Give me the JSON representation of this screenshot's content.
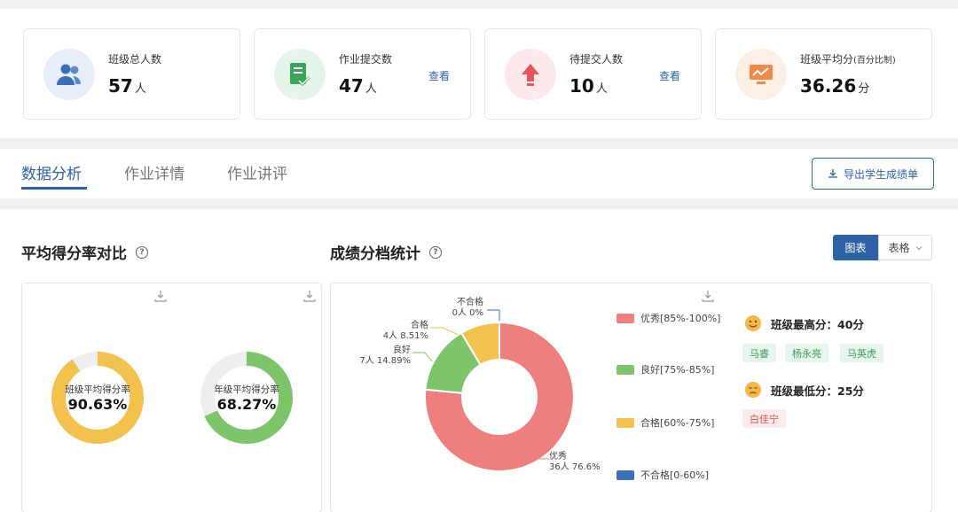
{
  "stats": [
    {
      "label": "班级总人数",
      "value": "57",
      "unit": "人",
      "link": "",
      "icon": "users-icon",
      "color": "#3d6fb8",
      "bg": "#e7eef9"
    },
    {
      "label": "作业提交数",
      "value": "47",
      "unit": "人",
      "link": "查看",
      "icon": "document-check-icon",
      "color": "#3ca35a",
      "bg": "#e5f5ea"
    },
    {
      "label": "待提交人数",
      "value": "10",
      "unit": "人",
      "link": "查看",
      "icon": "upload-arrow-icon",
      "color": "#e4575a",
      "bg": "#fde9e9"
    },
    {
      "label": "班级平均分",
      "label_sub": "(百分比制)",
      "value": "36.26",
      "unit": "分",
      "link": "",
      "icon": "chart-monitor-icon",
      "color": "#f08a4b",
      "bg": "#fdefe4"
    }
  ],
  "tabs": [
    "数据分析",
    "作业详情",
    "作业讲评"
  ],
  "export_button": "导出学生成绩单",
  "left_section": {
    "title": "平均得分率对比"
  },
  "right_section": {
    "title": "成绩分档统计",
    "toggle_chart": "图表",
    "toggle_table": "表格"
  },
  "donuts": [
    {
      "label": "班级平均得分率",
      "value": "90.63%",
      "percent": 90.63,
      "color": "#f2c14e"
    },
    {
      "label": "年级平均得分率",
      "value": "68.27%",
      "percent": 68.27,
      "color": "#7ec46b"
    }
  ],
  "chart_data": {
    "type": "pie",
    "categories": [
      "优秀[85%-100%]",
      "良好[75%-85%]",
      "合格[60%-75%]",
      "不合格[0-60%]"
    ],
    "series": [
      {
        "values": [
          36,
          7,
          4,
          0
        ]
      }
    ],
    "percentages": [
      "76.6%",
      "14.89%",
      "8.51%",
      "0%"
    ],
    "slice_names": [
      "优秀",
      "良好",
      "合格",
      "不合格"
    ],
    "slice_counts": [
      "36人",
      "7人",
      "4人",
      "0人"
    ],
    "colors": [
      "#ee7f7f",
      "#7ec46b",
      "#f2c14e",
      "#3d6fb8"
    ],
    "legend_position": "right"
  },
  "scores": {
    "highest_label": "班级最高分：40分",
    "highest_students": [
      "马睿",
      "杨永亮",
      "马英虎"
    ],
    "lowest_label": "班级最低分：25分",
    "lowest_students": [
      "白佳宁"
    ]
  }
}
